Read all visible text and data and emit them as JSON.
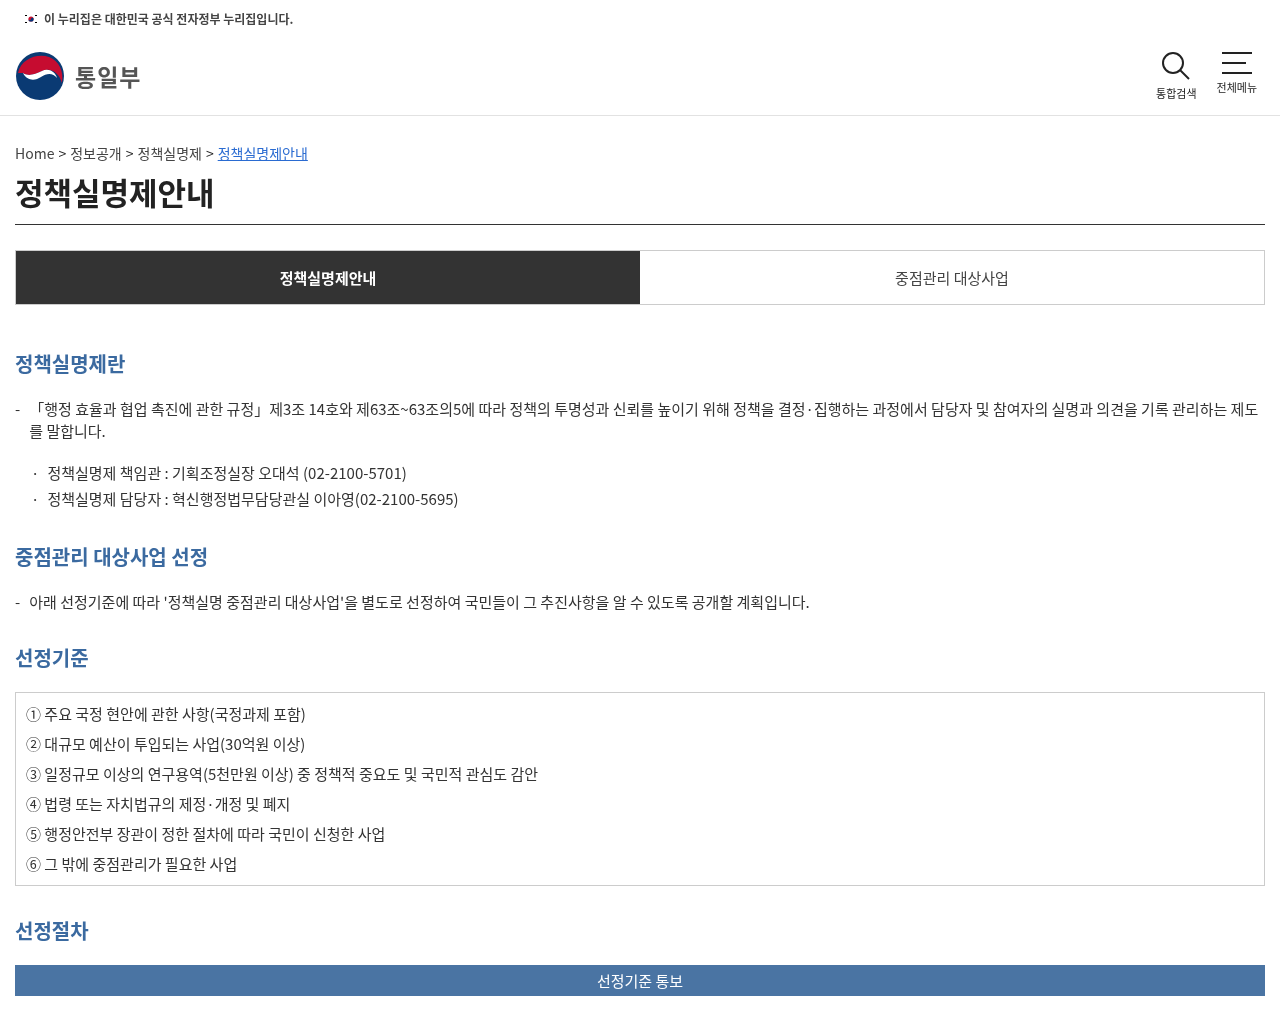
{
  "gov_banner": {
    "text": "이 누리집은 대한민국 공식 전자정부 누리집입니다."
  },
  "header": {
    "logo_text": "통일부",
    "actions": [
      {
        "kind": "search",
        "label": "통합검색"
      },
      {
        "kind": "menu",
        "label": "전체메뉴"
      }
    ]
  },
  "breadcrumb": [
    {
      "label": "Home",
      "selected": false
    },
    {
      "label": "정보공개",
      "selected": false
    },
    {
      "label": "정책실명제",
      "selected": false
    },
    {
      "label": "정책실명제안내",
      "selected": true
    }
  ],
  "breadcrumb_separator": ">",
  "page_title": "정책실명제안내",
  "tabs": [
    {
      "label": "정책실명제안내",
      "selected": true
    },
    {
      "label": "중점관리 대상사업",
      "selected": false
    }
  ],
  "sections": [
    {
      "heading": "정책실명제란",
      "blocks": [
        {
          "kind": "dash",
          "marker": "-",
          "text": "「행정 효율과 협업 촉진에 관한 규정」제3조 14호와 제63조~63조의5에 따라 정책의 투명성과 신뢰를 높이기 위해 정책을 결정·집행하는 과정에서 담당자 및 참여자의 실명과 의견을 기록 관리하는 제도를 말합니다."
        },
        {
          "kind": "bullets",
          "marker": "·",
          "items": [
            "정책실명제 책임관 : 기획조정실장 오대석 (02-2100-5701)",
            "정책실명제 담당자 : 혁신행정법무담당관실 이아영(02-2100-5695)"
          ]
        }
      ]
    },
    {
      "heading": "중점관리 대상사업 선정",
      "blocks": [
        {
          "kind": "dash",
          "marker": "-",
          "text": "아래 선정기준에 따라 '정책실명 중점관리 대상사업'을 별도로 선정하여 국민들이 그 추진사항을 알 수 있도록 공개할 계획입니다."
        }
      ]
    },
    {
      "heading": "선정기준",
      "blocks": [
        {
          "kind": "boxed_list",
          "items": [
            "① 주요 국정 현안에 관한 사항(국정과제 포함)",
            "② 대규모 예산이 투입되는 사업(30억원 이상)",
            "③ 일정규모 이상의 연구용역(5천만원 이상) 중 정책적 중요도 및 국민적 관심도 감안",
            "④ 법령 또는 자치법규의 제정·개정 및 폐지",
            "⑤ 행정안전부 장관이 정한 절차에 따라 국민이 신청한 사업",
            "⑥ 그 밖에 중점관리가 필요한 사업"
          ]
        }
      ]
    },
    {
      "heading": "선정절차",
      "blocks": [
        {
          "kind": "step_bar",
          "text": "선정기준 통보"
        }
      ]
    }
  ]
}
